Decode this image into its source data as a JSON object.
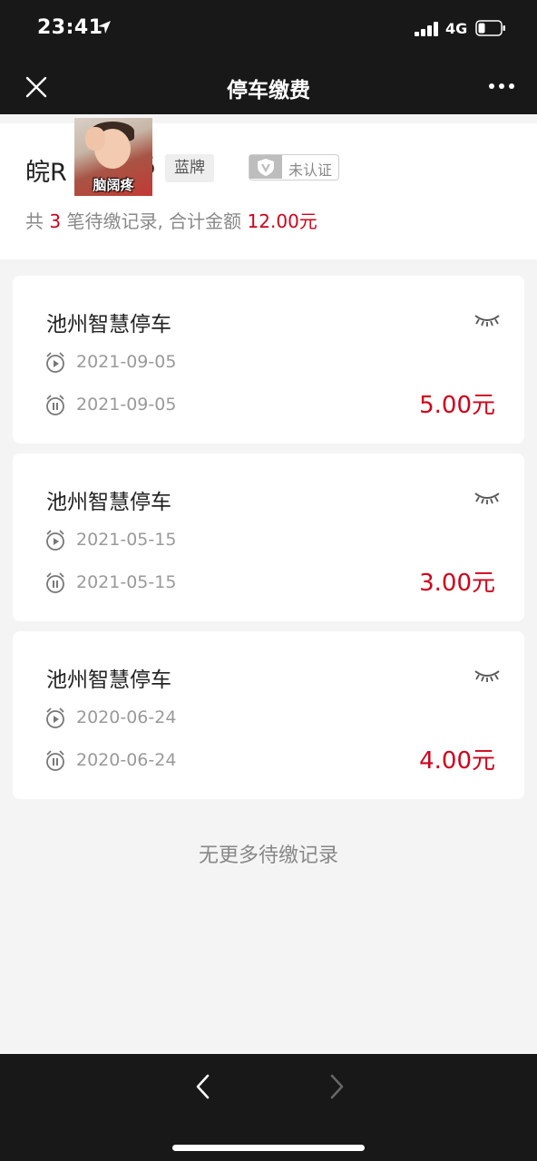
{
  "status": {
    "time": "23:41",
    "network": "4G"
  },
  "nav": {
    "title": "停车缴费"
  },
  "vehicle": {
    "plate_start": "皖R",
    "plate_end": "5",
    "sticker_text": "脑阔疼",
    "plate_color": "蓝牌",
    "verify": "未认证"
  },
  "summary": {
    "prefix": "共",
    "count": "3",
    "middle": "笔待缴记录, 合计金额",
    "total": "12.00元"
  },
  "records": [
    {
      "name": "池州智慧停车",
      "start": "2021-09-05",
      "end": "2021-09-05",
      "amount": "5.00元"
    },
    {
      "name": "池州智慧停车",
      "start": "2021-05-15",
      "end": "2021-05-15",
      "amount": "3.00元"
    },
    {
      "name": "池州智慧停车",
      "start": "2020-06-24",
      "end": "2020-06-24",
      "amount": "4.00元"
    }
  ],
  "footer": {
    "no_more": "无更多待缴记录"
  },
  "colors": {
    "accent": "#d0021b",
    "bar": "#181818",
    "bg": "#f4f4f4"
  },
  "icons": [
    "location-arrow-icon",
    "signal-icon",
    "battery-icon",
    "close-icon",
    "more-icon",
    "shield-v-icon",
    "eye-closed-icon",
    "alarm-play-icon",
    "alarm-pause-icon",
    "back-arrow-icon",
    "forward-arrow-icon"
  ]
}
